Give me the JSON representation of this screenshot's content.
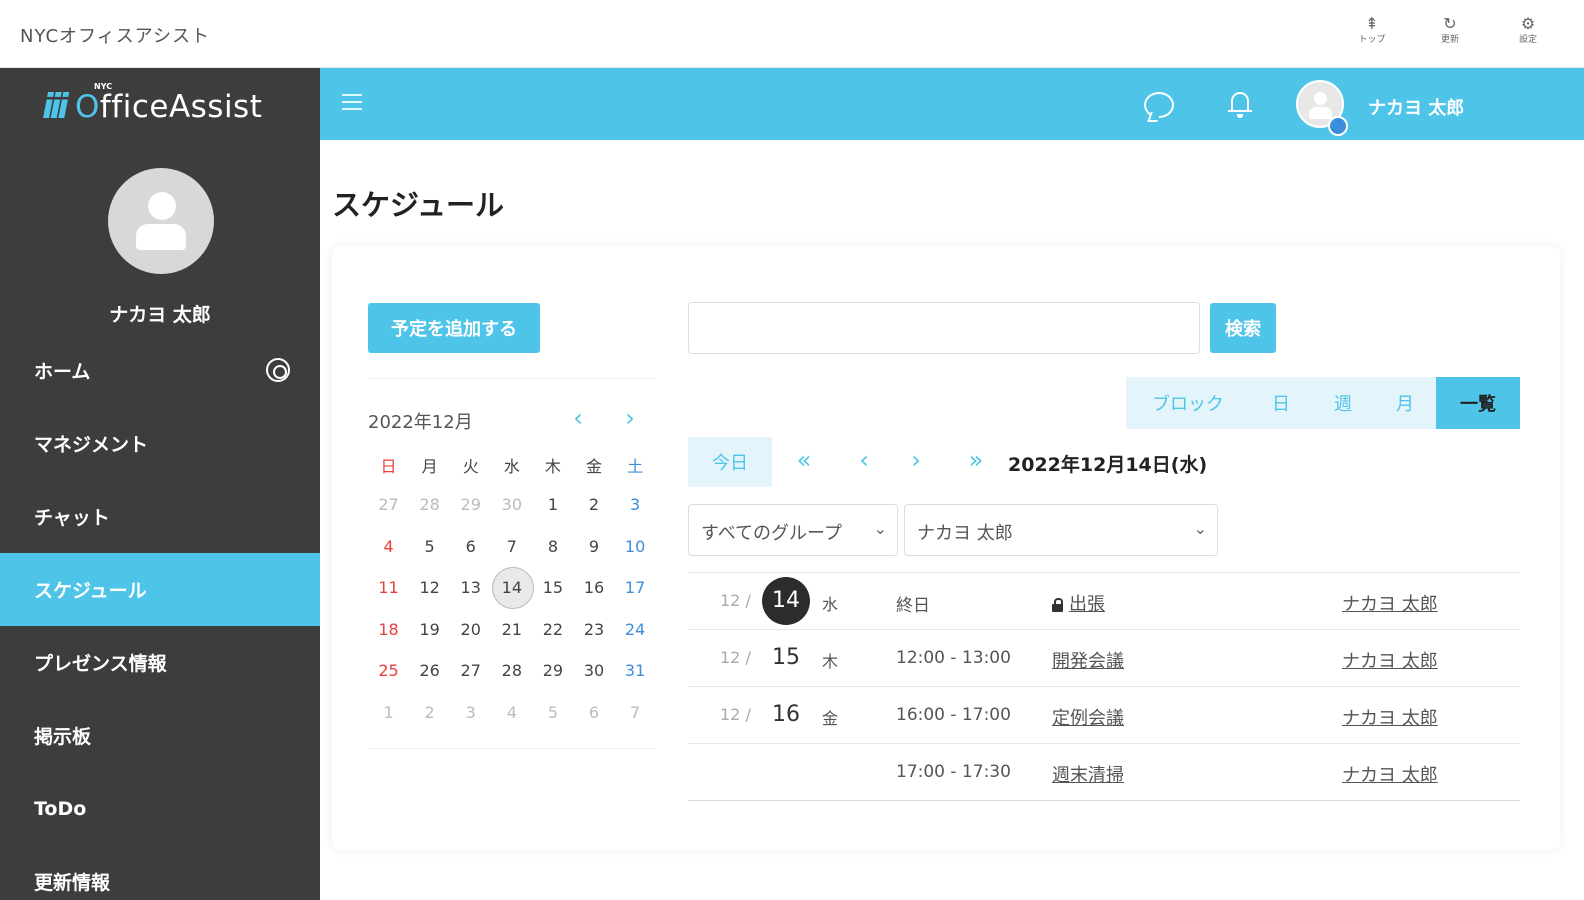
{
  "window": {
    "title": "NYCオフィスアシスト",
    "actions": [
      {
        "icon": "top-icon",
        "label": "トップ"
      },
      {
        "icon": "refresh-icon",
        "label": "更新"
      },
      {
        "icon": "settings-icon",
        "label": "設定"
      }
    ]
  },
  "brand": {
    "logo_text_o": "O",
    "logo_text_rest": "ffice",
    "logo_text_assist": "Assist",
    "logo_sup": "NYC",
    "logo_mark": "iii",
    "accent_color": "#4ec5e8",
    "sidebar_color": "#3d3d3d"
  },
  "sidebar": {
    "username": "ナカヨ 太郎",
    "items": [
      {
        "label": "ホーム",
        "active": false
      },
      {
        "label": "マネジメント",
        "active": false
      },
      {
        "label": "チャット",
        "active": false
      },
      {
        "label": "スケジュール",
        "active": true
      },
      {
        "label": "プレゼンス情報",
        "active": false
      },
      {
        "label": "掲示板",
        "active": false
      },
      {
        "label": "ToDo",
        "active": false
      },
      {
        "label": "更新情報",
        "active": false
      }
    ]
  },
  "header": {
    "username": "ナカヨ 太郎"
  },
  "page": {
    "title": "スケジュール"
  },
  "actions": {
    "add_label": "予定を追加する",
    "search_label": "検索",
    "search_value": ""
  },
  "calendar": {
    "month_label": "2022年12月",
    "dows": [
      "日",
      "月",
      "火",
      "水",
      "木",
      "金",
      "土"
    ],
    "weeks": [
      [
        "27",
        "28",
        "29",
        "30",
        "1",
        "2",
        "3"
      ],
      [
        "4",
        "5",
        "6",
        "7",
        "8",
        "9",
        "10"
      ],
      [
        "11",
        "12",
        "13",
        "14",
        "15",
        "16",
        "17"
      ],
      [
        "18",
        "19",
        "20",
        "21",
        "22",
        "23",
        "24"
      ],
      [
        "25",
        "26",
        "27",
        "28",
        "29",
        "30",
        "31"
      ],
      [
        "1",
        "2",
        "3",
        "4",
        "5",
        "6",
        "7"
      ]
    ],
    "today": "14"
  },
  "view_tabs": [
    {
      "label": "ブロック",
      "active": false
    },
    {
      "label": "日",
      "active": false
    },
    {
      "label": "週",
      "active": false
    },
    {
      "label": "月",
      "active": false
    },
    {
      "label": "一覧",
      "active": true
    }
  ],
  "date_nav": {
    "today_label": "今日",
    "current_date": "2022年12月14日(水)"
  },
  "filters": {
    "group": "すべてのグループ",
    "user": "ナカヨ 太郎"
  },
  "schedule": [
    {
      "month": "12 /",
      "day": "14",
      "dow": "水",
      "time": "終日",
      "title": "出張",
      "locked": true,
      "owner": "ナカヨ 太郎",
      "current": true
    },
    {
      "month": "12 /",
      "day": "15",
      "dow": "木",
      "time": "12:00 - 13:00",
      "title": "開発会議",
      "locked": false,
      "owner": "ナカヨ 太郎",
      "current": false
    },
    {
      "month": "12 /",
      "day": "16",
      "dow": "金",
      "time": "16:00 - 17:00",
      "title": "定例会議",
      "locked": false,
      "owner": "ナカヨ 太郎",
      "current": false
    },
    {
      "month": "",
      "day": "",
      "dow": "",
      "time": "17:00 - 17:30",
      "title": "週末清掃",
      "locked": false,
      "owner": "ナカヨ 太郎",
      "current": false
    }
  ]
}
